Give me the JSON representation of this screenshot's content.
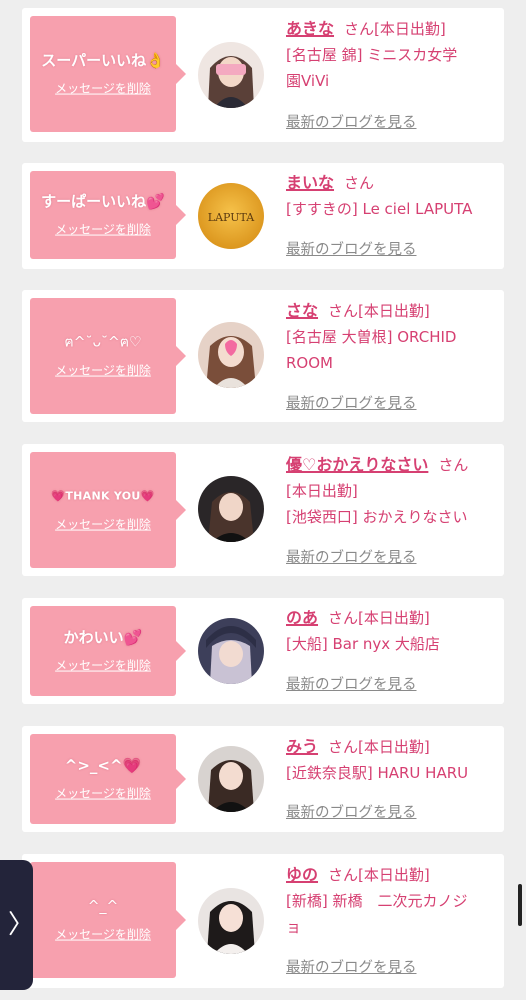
{
  "entries": [
    {
      "message": "スーパーいいね👌",
      "delete_label": "メッセージを削除",
      "name": "あきな",
      "san": "さん",
      "status": "[本日出勤]",
      "store_lines": [
        "[名古屋 錦] ミニスカ女学",
        "園ViVi"
      ],
      "blog_label": "最新のブログを見る",
      "avatar": "photo-woman-pink-stamp"
    },
    {
      "message": "すーぱーいいね💕",
      "delete_label": "メッセージを削除",
      "name": "まいな",
      "san": "さん",
      "status": "",
      "store_lines": [
        "[すすきの] Le ciel LAPUTA"
      ],
      "blog_label": "最新のブログを見る",
      "avatar": "laputa-logo",
      "avatar_text": "LAPUTA"
    },
    {
      "message": "ฅ^˘ᴗ˘^ฅ♡",
      "delete_label": "メッセージを削除",
      "name": "さな",
      "san": "さん",
      "status": "[本日出勤]",
      "store_lines": [
        "[名古屋 大曽根] ORCHID",
        "ROOM"
      ],
      "blog_label": "最新のブログを見る",
      "avatar": "photo-woman-heart-stamp"
    },
    {
      "message": "💗THANK YOU💗",
      "delete_label": "メッセージを削除",
      "name": "優♡おかえりなさい",
      "san": "さん",
      "status": "[本日出勤]",
      "store_lines": [
        "[池袋西口] おかえりなさい"
      ],
      "blog_label": "最新のブログを見る",
      "avatar": "photo-woman-dark"
    },
    {
      "message": "かわいい💕",
      "delete_label": "メッセージを削除",
      "name": "のあ",
      "san": "さん",
      "status": "[本日出勤]",
      "store_lines": [
        "[大船] Bar nyx 大船店"
      ],
      "blog_label": "最新のブログを見る",
      "avatar": "photo-woman-hat"
    },
    {
      "message": "^>_<^💗",
      "delete_label": "メッセージを削除",
      "name": "みう",
      "san": "さん",
      "status": "[本日出勤]",
      "store_lines": [
        "[近鉄奈良駅] HARU HARU"
      ],
      "blog_label": "最新のブログを見る",
      "avatar": "photo-woman-black-shirt"
    },
    {
      "message": "^_^",
      "delete_label": "メッセージを削除",
      "name": "ゆの",
      "san": "さん",
      "status": "[本日出勤]",
      "store_lines": [
        "[新橋] 新橋　二次元カノジ",
        "ョ"
      ],
      "blog_label": "最新のブログを見る",
      "avatar": "photo-woman-peace-sign"
    }
  ],
  "side_tab": {
    "icon": "chevron-right-icon",
    "glyph": "〉"
  },
  "colors": {
    "accent": "#d64072",
    "bubble": "#f7a0ae",
    "link_gray": "#8a8a8a",
    "background": "#eeeeee"
  }
}
